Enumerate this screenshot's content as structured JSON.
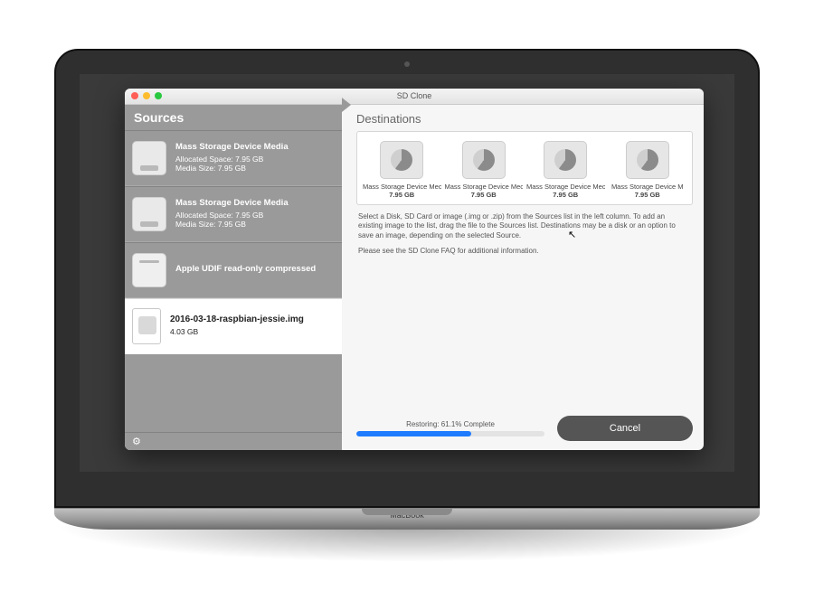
{
  "device_label": "MacBook",
  "window": {
    "title": "SD Clone"
  },
  "left": {
    "header": "Sources",
    "items": [
      {
        "name": "Mass Storage Device Media",
        "allocated": "Allocated Space: 7.95 GB",
        "media": "Media Size: 7.95 GB",
        "icon": "hd"
      },
      {
        "name": "Mass Storage Device Media",
        "allocated": "Allocated Space: 7.95 GB",
        "media": "Media Size: 7.95 GB",
        "icon": "hd"
      },
      {
        "name": "Apple UDIF read-only compressed",
        "allocated": "",
        "media": "",
        "icon": "od"
      },
      {
        "name": "2016-03-18-raspbian-jessie.img",
        "allocated": "4.03 GB",
        "media": "",
        "icon": "file",
        "selected": true
      }
    ],
    "gear_icon": "⚙"
  },
  "right": {
    "header": "Destinations",
    "destinations": [
      {
        "name": "Mass Storage Device Mec",
        "size": "7.95 GB"
      },
      {
        "name": "Mass Storage Device Mec",
        "size": "7.95 GB"
      },
      {
        "name": "Mass Storage Device Mec",
        "size": "7.95 GB"
      },
      {
        "name": "Mass Storage Device M",
        "size": "7.95 GB"
      }
    ],
    "check_glyph": "✓",
    "instructions_p1": "Select a Disk, SD Card or image (.img or .zip) from the Sources list in the left column.  To add an existing image to the list, drag the file to the Sources list.  Destinations may be a disk or an option to save an image, depending on the selected Source.",
    "instructions_p2": "Please see the SD Clone FAQ for additional information.",
    "progress_label": "Restoring: 61.1% Complete",
    "progress_percent": 61.1,
    "cancel_label": "Cancel"
  }
}
